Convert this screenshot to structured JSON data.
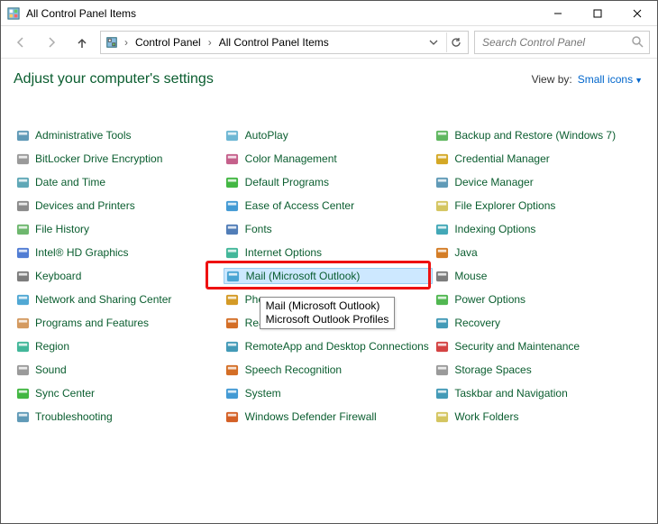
{
  "window": {
    "title": "All Control Panel Items"
  },
  "breadcrumb": {
    "root": "Control Panel",
    "current": "All Control Panel Items"
  },
  "search": {
    "placeholder": "Search Control Panel"
  },
  "header": {
    "heading": "Adjust your computer's settings",
    "viewby_label": "View by:",
    "viewby_value": "Small icons"
  },
  "columns": [
    [
      {
        "name": "administrative-tools",
        "label": "Administrative Tools",
        "icon": "tools"
      },
      {
        "name": "bitlocker",
        "label": "BitLocker Drive Encryption",
        "icon": "lock"
      },
      {
        "name": "date-time",
        "label": "Date and Time",
        "icon": "clock"
      },
      {
        "name": "devices-printers",
        "label": "Devices and Printers",
        "icon": "printer"
      },
      {
        "name": "file-history",
        "label": "File History",
        "icon": "history"
      },
      {
        "name": "intel-hd",
        "label": "Intel® HD Graphics",
        "icon": "monitor"
      },
      {
        "name": "keyboard",
        "label": "Keyboard",
        "icon": "keyboard"
      },
      {
        "name": "network-sharing",
        "label": "Network and Sharing Center",
        "icon": "network"
      },
      {
        "name": "programs-features",
        "label": "Programs and Features",
        "icon": "box"
      },
      {
        "name": "region",
        "label": "Region",
        "icon": "globe"
      },
      {
        "name": "sound",
        "label": "Sound",
        "icon": "speaker"
      },
      {
        "name": "sync-center",
        "label": "Sync Center",
        "icon": "sync"
      },
      {
        "name": "troubleshooting",
        "label": "Troubleshooting",
        "icon": "wrench"
      }
    ],
    [
      {
        "name": "autoplay",
        "label": "AutoPlay",
        "icon": "disc"
      },
      {
        "name": "color-management",
        "label": "Color Management",
        "icon": "palette"
      },
      {
        "name": "default-programs",
        "label": "Default Programs",
        "icon": "check"
      },
      {
        "name": "ease-access",
        "label": "Ease of Access Center",
        "icon": "access"
      },
      {
        "name": "fonts",
        "label": "Fonts",
        "icon": "font"
      },
      {
        "name": "internet-options",
        "label": "Internet Options",
        "icon": "globe2"
      },
      {
        "name": "mail",
        "label": "Mail (Microsoft Outlook)",
        "icon": "mail",
        "highlight": true
      },
      {
        "name": "phone-modem",
        "label": "Phone and Modem",
        "icon": "phone",
        "truncated": "Phon"
      },
      {
        "name": "realtek",
        "label": "Realtek HD Audio Manager",
        "icon": "speaker2",
        "truncated": "Realt"
      },
      {
        "name": "remoteapp",
        "label": "RemoteApp and Desktop Connections",
        "icon": "remote"
      },
      {
        "name": "speech",
        "label": "Speech Recognition",
        "icon": "mic"
      },
      {
        "name": "system",
        "label": "System",
        "icon": "pc"
      },
      {
        "name": "defender-firewall",
        "label": "Windows Defender Firewall",
        "icon": "firewall"
      }
    ],
    [
      {
        "name": "backup-restore",
        "label": "Backup and Restore (Windows 7)",
        "icon": "backup"
      },
      {
        "name": "credential-manager",
        "label": "Credential Manager",
        "icon": "vault"
      },
      {
        "name": "device-manager",
        "label": "Device Manager",
        "icon": "device"
      },
      {
        "name": "file-explorer-options",
        "label": "File Explorer Options",
        "icon": "folder"
      },
      {
        "name": "indexing",
        "label": "Indexing Options",
        "icon": "index"
      },
      {
        "name": "java",
        "label": "Java",
        "icon": "java"
      },
      {
        "name": "mouse",
        "label": "Mouse",
        "icon": "mouse"
      },
      {
        "name": "power-options",
        "label": "Power Options",
        "icon": "power"
      },
      {
        "name": "recovery",
        "label": "Recovery",
        "icon": "recovery"
      },
      {
        "name": "security-maintenance",
        "label": "Security and Maintenance",
        "icon": "flag"
      },
      {
        "name": "storage-spaces",
        "label": "Storage Spaces",
        "icon": "storage"
      },
      {
        "name": "taskbar-nav",
        "label": "Taskbar and Navigation",
        "icon": "taskbar"
      },
      {
        "name": "work-folders",
        "label": "Work Folders",
        "icon": "workfolder"
      }
    ]
  ],
  "tooltip": {
    "line1": "Mail (Microsoft Outlook)",
    "line2": "Microsoft Outlook Profiles"
  }
}
